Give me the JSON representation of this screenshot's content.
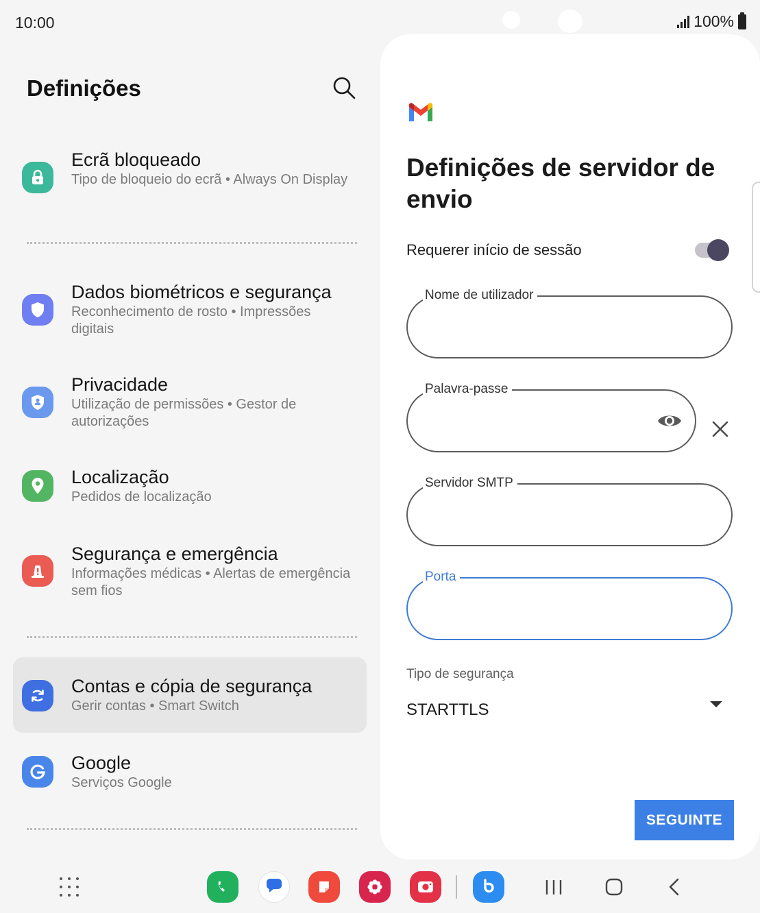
{
  "status_bar": {
    "time": "10:00",
    "battery": "100%"
  },
  "left_panel": {
    "title": "Definições",
    "items": [
      {
        "title": "Ecrã bloqueado",
        "subtitle": "Tipo de bloqueio do ecrã  •  Always On Display",
        "icon": "lock-icon",
        "color": "#3cb89a"
      },
      {
        "title": "Dados biométricos e segurança",
        "subtitle": "Reconhecimento de rosto  •  Impressões digitais",
        "icon": "shield-icon",
        "color": "#6f7ef1"
      },
      {
        "title": "Privacidade",
        "subtitle": "Utilização de permissões  •  Gestor de autorizações",
        "icon": "privacy-icon",
        "color": "#6a99ee"
      },
      {
        "title": "Localização",
        "subtitle": "Pedidos de localização",
        "icon": "location-pin-icon",
        "color": "#52b561"
      },
      {
        "title": "Segurança e emergência",
        "subtitle": "Informações médicas  •  Alertas de emergência sem fios",
        "icon": "emergency-icon",
        "color": "#ea5b54"
      },
      {
        "title": "Contas e cópia de segurança",
        "subtitle": "Gerir contas  •  Smart Switch",
        "icon": "sync-icon",
        "color": "#3f6fe0"
      },
      {
        "title": "Google",
        "subtitle": "Serviços Google",
        "icon": "google-icon",
        "color": "#4a86ea"
      }
    ]
  },
  "right_panel": {
    "heading": "Definições de servidor de envio",
    "require_signin_label": "Requerer início de sessão",
    "require_signin_enabled": true,
    "fields": {
      "username_label": "Nome de utilizador",
      "username_value": "",
      "password_label": "Palavra-passe",
      "password_value": "",
      "smtp_label": "Servidor SMTP",
      "smtp_value": "",
      "port_label": "Porta",
      "port_value": ""
    },
    "security_type_label": "Tipo de segurança",
    "security_type_value": "STARTTLS",
    "next_button": "SEGUINTE"
  },
  "colors": {
    "accent": "#3c80e6",
    "focus_border": "#3e7bd6",
    "toggle_knob": "#4b4760"
  }
}
